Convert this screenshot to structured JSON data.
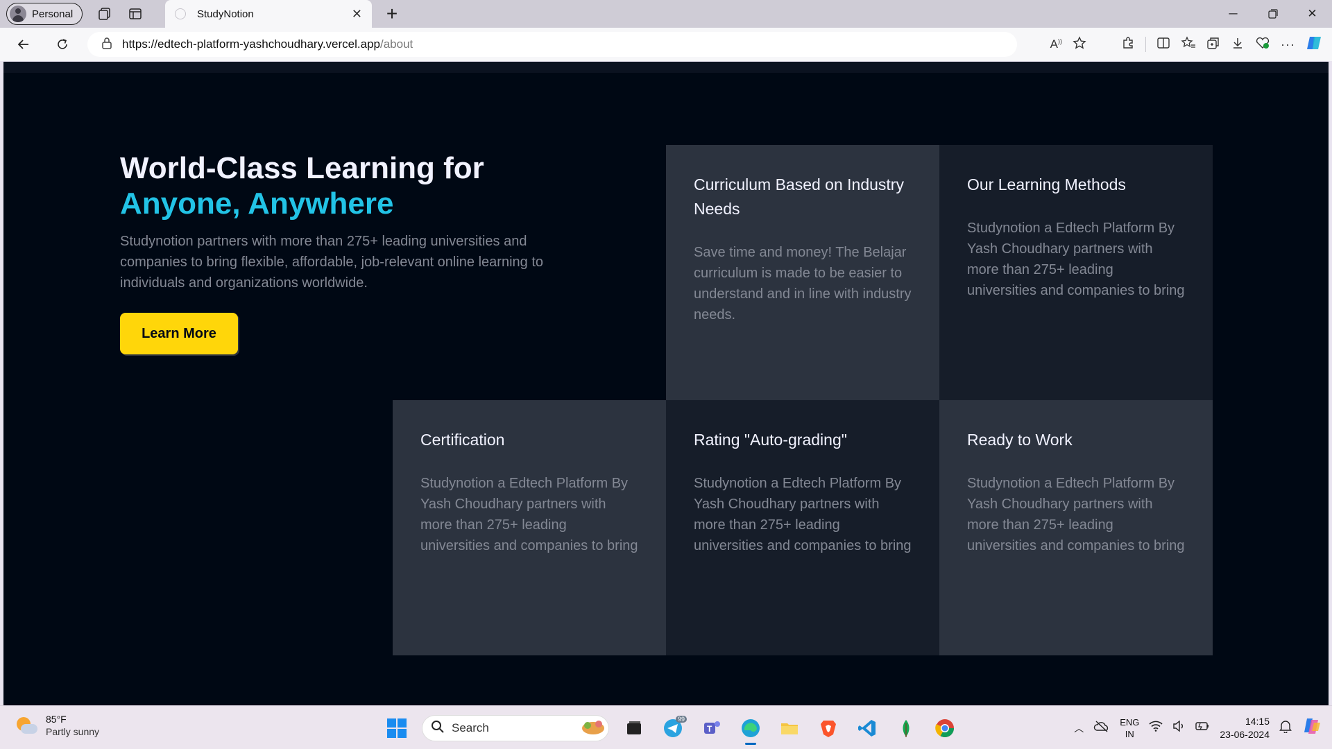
{
  "browser": {
    "profile_label": "Personal",
    "tab_title": "StudyNotion",
    "url_host": "https://edtech-platform-yashchoudhary.vercel.app",
    "url_path": "/about"
  },
  "hero": {
    "heading_line1": "World-Class Learning for",
    "heading_highlight": "Anyone, Anywhere",
    "description": "Studynotion partners with more than 275+ leading universities and companies to bring flexible, affordable, job-relevant online learning to individuals and organizations worldwide.",
    "button_label": "Learn More"
  },
  "cards": [
    {
      "title": "Curriculum Based on Industry Needs",
      "body": "Save time and money! The Belajar curriculum is made to be easier to understand and in line with industry needs."
    },
    {
      "title": "Our Learning Methods",
      "body": "Studynotion a Edtech Platform By Yash Choudhary partners with more than 275+ leading universities and companies to bring"
    },
    {
      "title": "Certification",
      "body": "Studynotion a Edtech Platform By Yash Choudhary partners with more than 275+ leading universities and companies to bring"
    },
    {
      "title": "Rating \"Auto-grading\"",
      "body": "Studynotion a Edtech Platform By Yash Choudhary partners with more than 275+ leading universities and companies to bring"
    },
    {
      "title": "Ready to Work",
      "body": "Studynotion a Edtech Platform By Yash Choudhary partners with more than 275+ leading universities and companies to bring"
    }
  ],
  "taskbar": {
    "weather_temp": "85°F",
    "weather_cond": "Partly sunny",
    "search_placeholder": "Search",
    "lang_line1": "ENG",
    "lang_line2": "IN",
    "time": "14:15",
    "date": "23-06-2024",
    "telegram_badge": "99"
  },
  "colors": {
    "page_bg": "#000814",
    "highlight": "#22c3e6",
    "button_yellow": "#ffd60a",
    "card_light": "#2c333f",
    "card_dark": "#161d29"
  }
}
